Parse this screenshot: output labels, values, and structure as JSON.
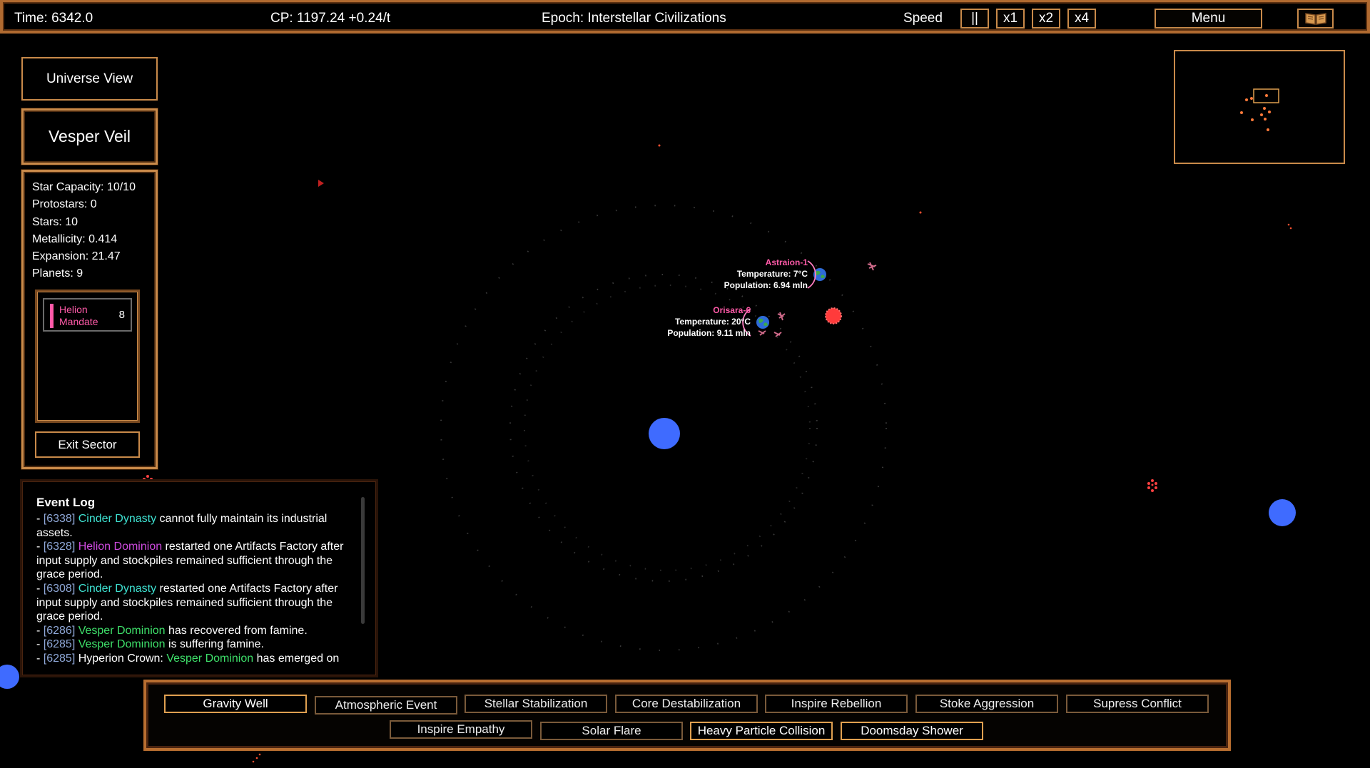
{
  "topbar": {
    "time": "Time: 6342.0",
    "cp": "CP: 1197.24 +0.24/t",
    "epoch": "Epoch: Interstellar Civilizations",
    "speed_label": "Speed",
    "pause": "||",
    "x1": "x1",
    "x2": "x2",
    "x4": "x4",
    "menu": "Menu"
  },
  "sidebar": {
    "universe_view": "Universe View",
    "sector_name": "Vesper Veil",
    "stats": [
      "Star Capacity: 10/10",
      "Protostars: 0",
      "Stars: 10",
      "Metallicity: 0.414",
      "Expansion: 21.47",
      "Planets: 9"
    ],
    "factions": [
      {
        "name_line1": "Helion",
        "name_line2": "Mandate",
        "count": "8",
        "color": "#ff5aa8"
      }
    ],
    "exit_sector": "Exit Sector"
  },
  "planets": [
    {
      "name": "Astraion-1",
      "temperature": "Temperature: 7°C",
      "population": "Population: 6.94 mln"
    },
    {
      "name": "Orisara-6",
      "temperature": "Temperature: 20°C",
      "population": "Population: 9.11 mln"
    }
  ],
  "event_log": {
    "title": "Event Log",
    "entries": [
      {
        "pre": "- ",
        "ts": "[6338]",
        "faction": "Cinder Dynasty",
        "fclass": "f-cinder",
        "mid": "",
        "text": " cannot fully maintain its industrial assets."
      },
      {
        "pre": "- ",
        "ts": "[6328]",
        "faction": "Helion Dominion",
        "fclass": "f-helion",
        "mid": "",
        "text": " restarted one Artifacts Factory after input supply and stockpiles remained sufficient through the grace period."
      },
      {
        "pre": "- ",
        "ts": "[6308]",
        "faction": "Cinder Dynasty",
        "fclass": "f-cinder",
        "mid": "",
        "text": " restarted one Artifacts Factory after input supply and stockpiles remained sufficient through the grace period."
      },
      {
        "pre": "- ",
        "ts": "[6286]",
        "faction": "Vesper Dominion",
        "fclass": "f-vesper",
        "mid": "",
        "text": " has recovered from famine."
      },
      {
        "pre": "- ",
        "ts": "[6285]",
        "faction": "Vesper Dominion",
        "fclass": "f-vesper",
        "mid": "",
        "text": " is suffering famine."
      },
      {
        "pre": "- ",
        "ts": "[6285]",
        "faction": "Vesper Dominion",
        "fclass": "f-vesper",
        "mid": " Hyperion Crown: ",
        "text": " has emerged on"
      }
    ]
  },
  "actions": {
    "row1": [
      "Gravity Well",
      "Atmospheric Event",
      "Stellar Stabilization",
      "Core Destabilization",
      "Inspire Rebellion",
      "Stoke Aggression",
      "Supress Conflict"
    ],
    "row2": [
      "Inspire Empathy",
      "Solar Flare",
      "Heavy Particle Collision",
      "Doomsday Shower"
    ]
  },
  "colors": {
    "frame": "#c98a4a",
    "planet_label": "#ff5aa8",
    "star_blue": "#3f6bff",
    "red_star": "#ff3b3b"
  }
}
